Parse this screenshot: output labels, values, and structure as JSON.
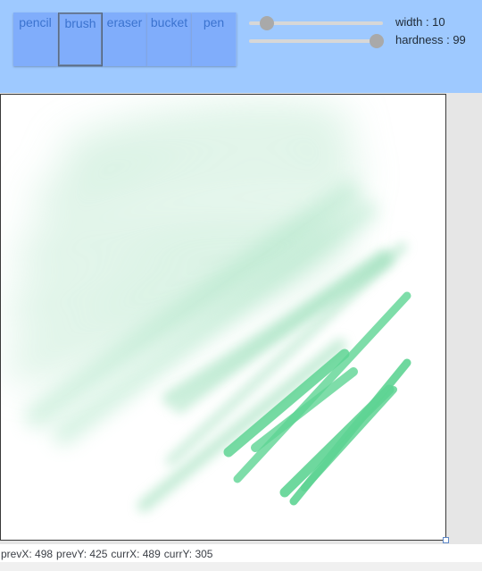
{
  "tools": [
    {
      "label": "pencil",
      "active": false
    },
    {
      "label": "brush",
      "active": true
    },
    {
      "label": "eraser",
      "active": false
    },
    {
      "label": "bucket",
      "active": false
    },
    {
      "label": "pen",
      "active": false
    }
  ],
  "sliders": {
    "width": {
      "label": "width : 10",
      "value": 10,
      "fraction": 0.13
    },
    "hardness": {
      "label": "hardness : 99",
      "value": 99,
      "fraction": 0.95
    }
  },
  "colors": {
    "toolbar_bg": "#9ec9ff",
    "tool_bg": "#80adfb",
    "tool_text": "#3b73cf",
    "stroke": "#5ed493"
  },
  "status": {
    "prevX": "prevX: 498",
    "prevY": "prevY: 425",
    "currX": "currX: 489",
    "currY": "currY: 305"
  }
}
